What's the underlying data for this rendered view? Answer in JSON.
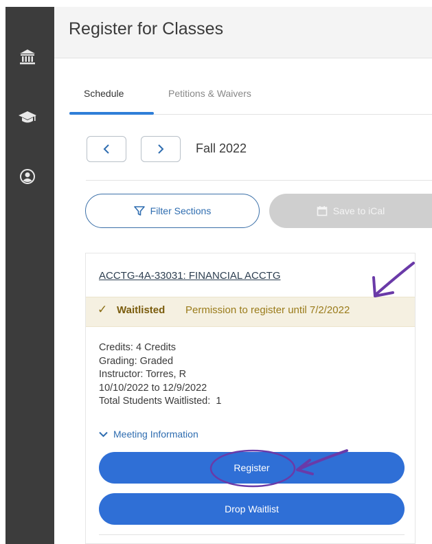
{
  "page": {
    "title": "Register for Classes"
  },
  "sidebar": {
    "items": [
      {
        "icon": "institution-icon"
      },
      {
        "icon": "graduation-cap-icon"
      },
      {
        "icon": "user-icon"
      }
    ]
  },
  "tabs": [
    {
      "label": "Schedule",
      "active": true
    },
    {
      "label": "Petitions & Waivers",
      "active": false
    }
  ],
  "term": {
    "label": "Fall 2022",
    "prev_icon": "chevron-left-icon",
    "next_icon": "chevron-right-icon"
  },
  "actions": {
    "filter_label": "Filter Sections",
    "ical_label": "Save to iCal"
  },
  "course": {
    "title": "ACCTG-4A-33031: FINANCIAL ACCTG",
    "status": "Waitlisted",
    "status_note": "Permission to register until 7/2/2022",
    "credits": "Credits: 4 Credits",
    "grading": "Grading: Graded",
    "instructor": "Instructor: Torres, R",
    "dates": "10/10/2022 to 12/9/2022",
    "waitlisted": "Total Students Waitlisted:  1",
    "meeting_label": "Meeting Information",
    "register_label": "Register",
    "drop_label": "Drop Waitlist"
  },
  "colors": {
    "accent": "#2f6fd6",
    "sidebar": "#3c3c3c",
    "waitlist_bg": "#f5f0e1",
    "annotation": "#6a3aa8"
  }
}
